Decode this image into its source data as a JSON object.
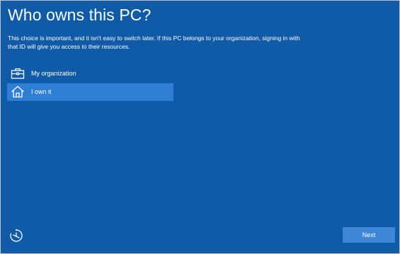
{
  "page": {
    "title": "Who owns this PC?",
    "description": "This choice is important, and it isn't easy to switch later. If this PC belongs to your organization, signing in with that ID will give you access to their resources."
  },
  "options": [
    {
      "label": "My organization",
      "icon": "briefcase-icon",
      "selected": false
    },
    {
      "label": "I own it",
      "icon": "home-icon",
      "selected": true
    }
  ],
  "footer": {
    "ease_of_access_icon": "ease-of-access-icon",
    "next_label": "Next"
  },
  "colors": {
    "background": "#0f5ba8",
    "selected_option": "#2f7fd6",
    "button": "#3e86d6",
    "text": "#ffffff"
  }
}
